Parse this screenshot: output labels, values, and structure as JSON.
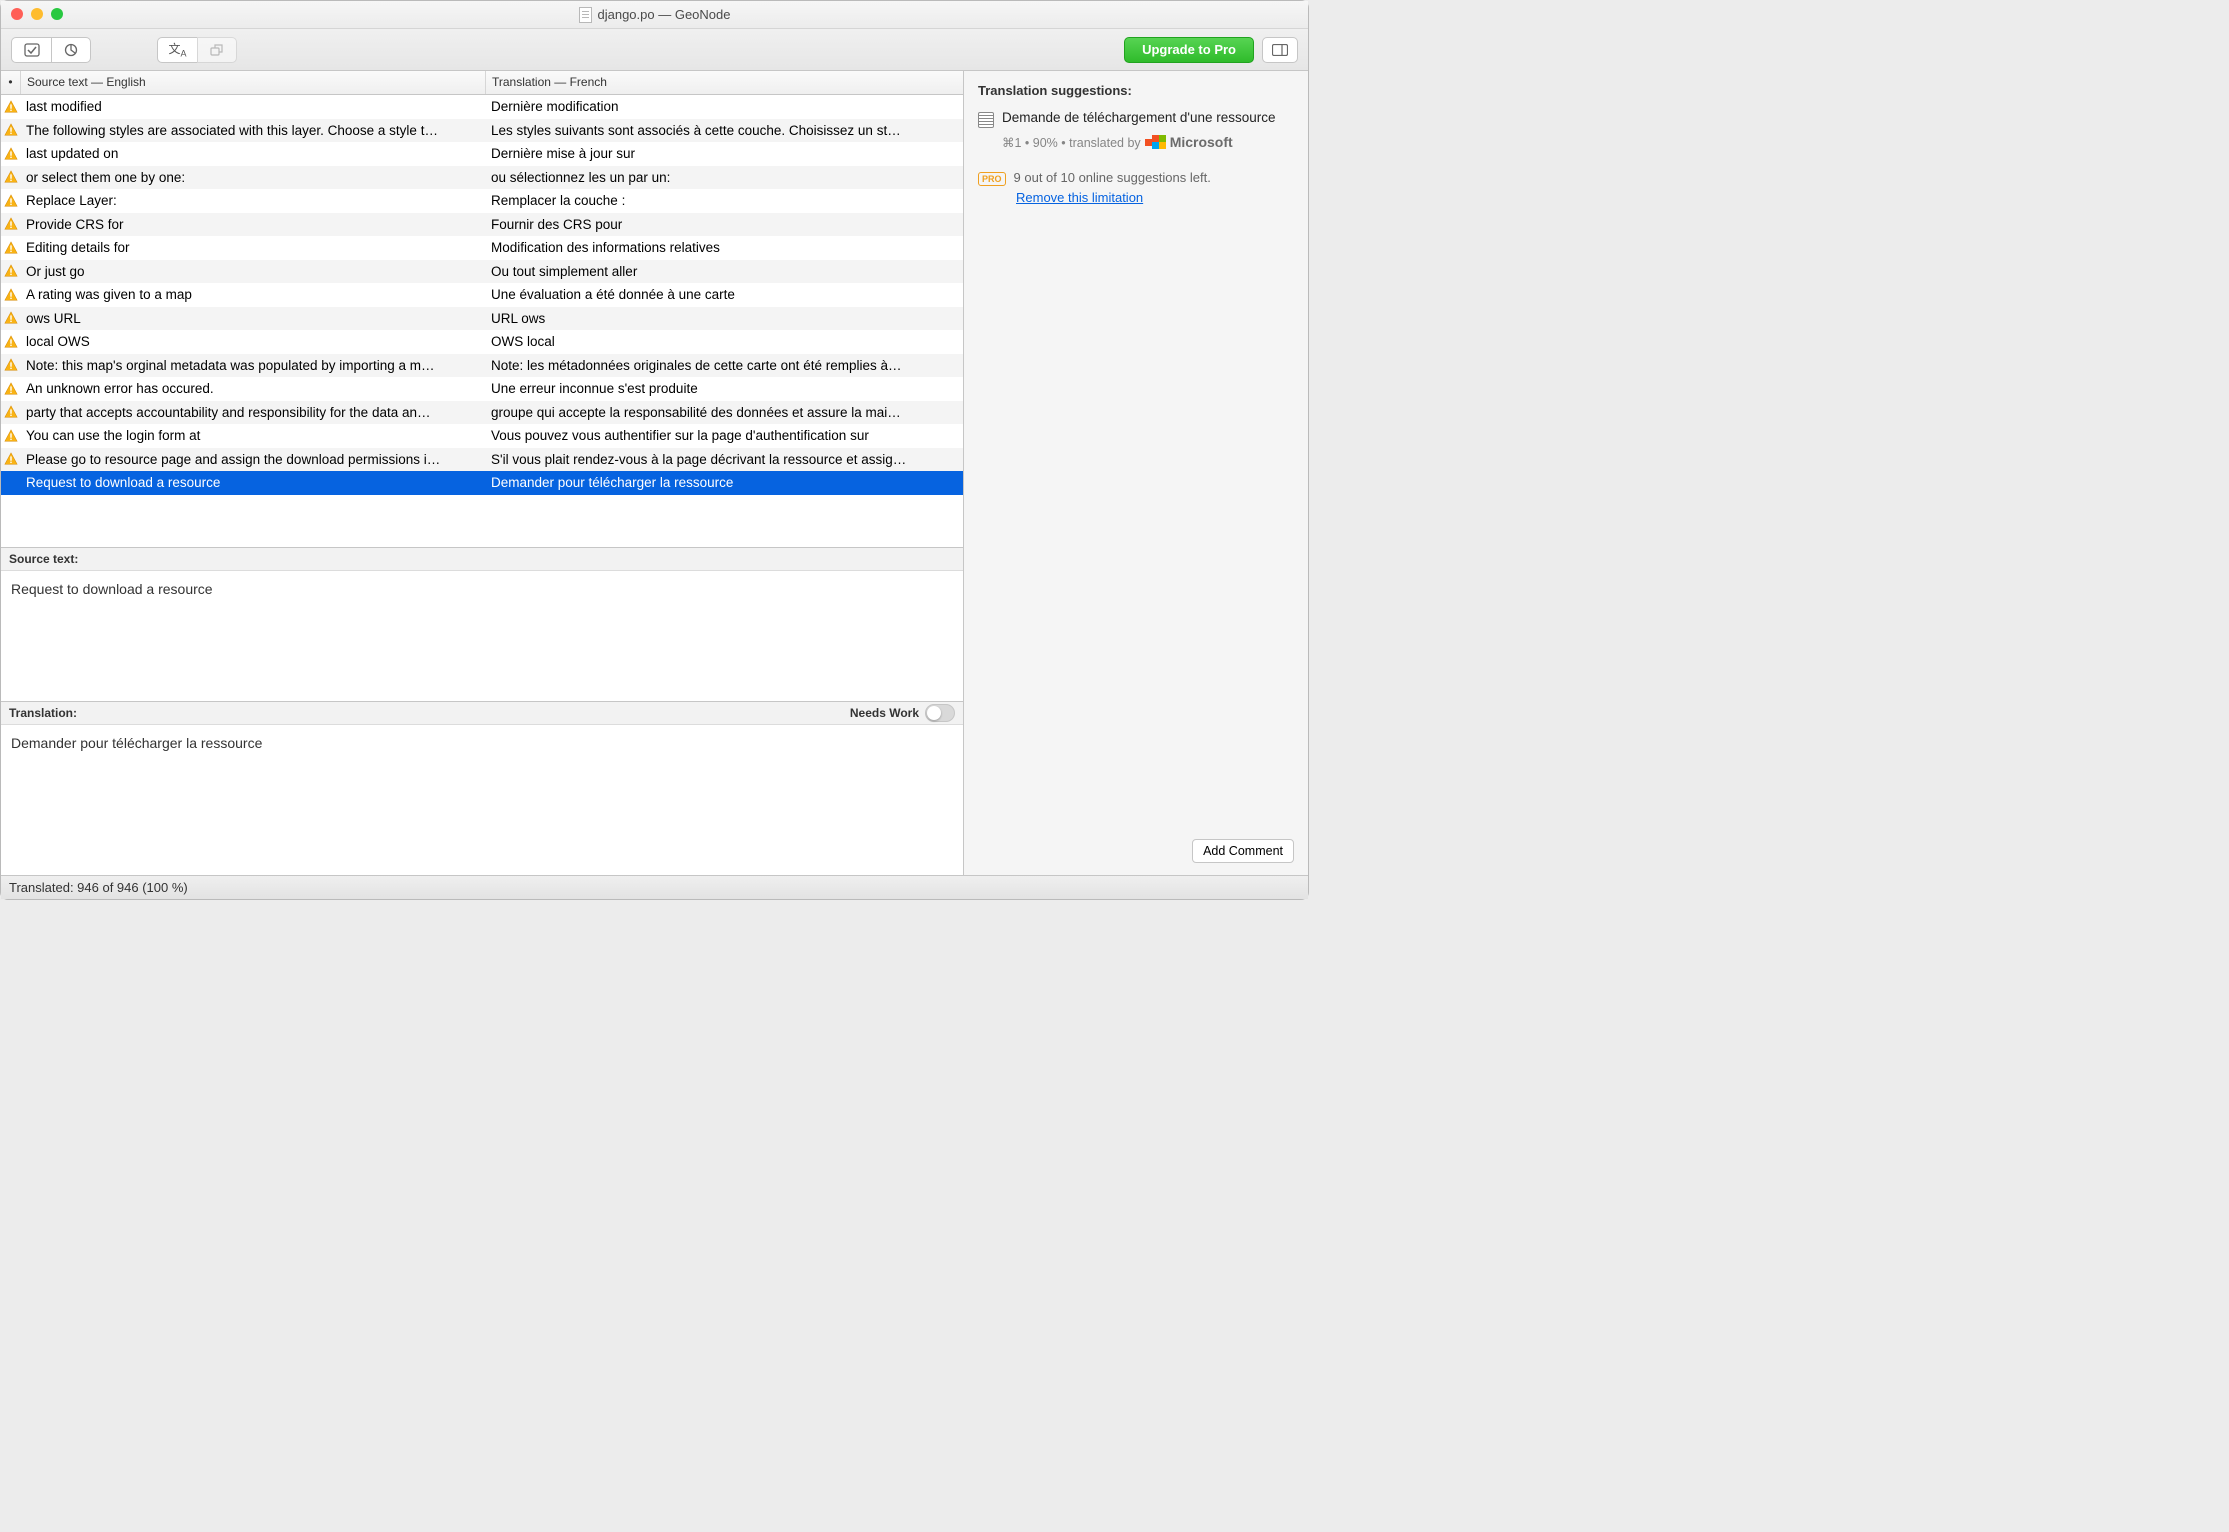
{
  "window": {
    "title": "django.po — GeoNode"
  },
  "toolbar": {
    "upgrade_label": "Upgrade to Pro"
  },
  "headers": {
    "status": "•",
    "source": "Source text — English",
    "translation": "Translation — French"
  },
  "rows": [
    {
      "warn": true,
      "src": "last modified",
      "tr": "Dernière modification"
    },
    {
      "warn": true,
      "src": "The following styles are associated with this layer. Choose a style t…",
      "tr": "Les styles suivants sont associés à cette couche. Choisissez un st…"
    },
    {
      "warn": true,
      "src": "last updated on",
      "tr": "Dernière mise à jour sur"
    },
    {
      "warn": true,
      "src": "or select them one by one:",
      "tr": "ou sélectionnez les un par un:"
    },
    {
      "warn": true,
      "src": "Replace Layer:",
      "tr": "Remplacer la couche :"
    },
    {
      "warn": true,
      "src": "Provide CRS for",
      "tr": "Fournir des CRS pour"
    },
    {
      "warn": true,
      "src": "Editing details for",
      "tr": "Modification des informations relatives"
    },
    {
      "warn": true,
      "src": "Or just go",
      "tr": "Ou tout simplement aller"
    },
    {
      "warn": true,
      "src": "A rating was given to a map",
      "tr": "Une évaluation a été donnée à une carte"
    },
    {
      "warn": true,
      "src": "ows URL",
      "tr": "URL ows"
    },
    {
      "warn": true,
      "src": "local OWS",
      "tr": "OWS local"
    },
    {
      "warn": true,
      "src": "Note: this map's orginal metadata was populated by importing a m…",
      "tr": "Note: les métadonnées originales de cette carte ont été remplies à…"
    },
    {
      "warn": true,
      "src": "An unknown error has occured.",
      "tr": "Une erreur inconnue s'est produite"
    },
    {
      "warn": true,
      "src": "party that accepts accountability and responsibility for the data an…",
      "tr": "groupe qui accepte la responsabilité des données et assure la mai…"
    },
    {
      "warn": true,
      "src": "You can use the login form at",
      "tr": "Vous pouvez vous authentifier sur la page d'authentification sur"
    },
    {
      "warn": true,
      "src": "Please go to resource page and assign the download permissions i…",
      "tr": "S'il vous plait rendez-vous à la page décrivant la ressource et assig…"
    },
    {
      "warn": false,
      "selected": true,
      "src": "Request to download a resource",
      "tr": "Demander pour télécharger la ressource"
    }
  ],
  "editor": {
    "source_label": "Source text:",
    "translation_label": "Translation:",
    "needs_work_label": "Needs Work",
    "source_value": "Request to download a resource",
    "translation_value": "Demander pour télécharger la ressource"
  },
  "sidebar": {
    "heading": "Translation suggestions:",
    "suggestion_text": "Demande de téléchargement d'une ressource",
    "meta_prefix": "⌘1 • 90% • translated by",
    "provider_name": "Microsoft",
    "pro_text": "9 out of 10 online suggestions left.",
    "pro_link": "Remove this limitation",
    "add_comment_label": "Add Comment"
  },
  "status_text": "Translated: 946 of 946 (100 %)"
}
